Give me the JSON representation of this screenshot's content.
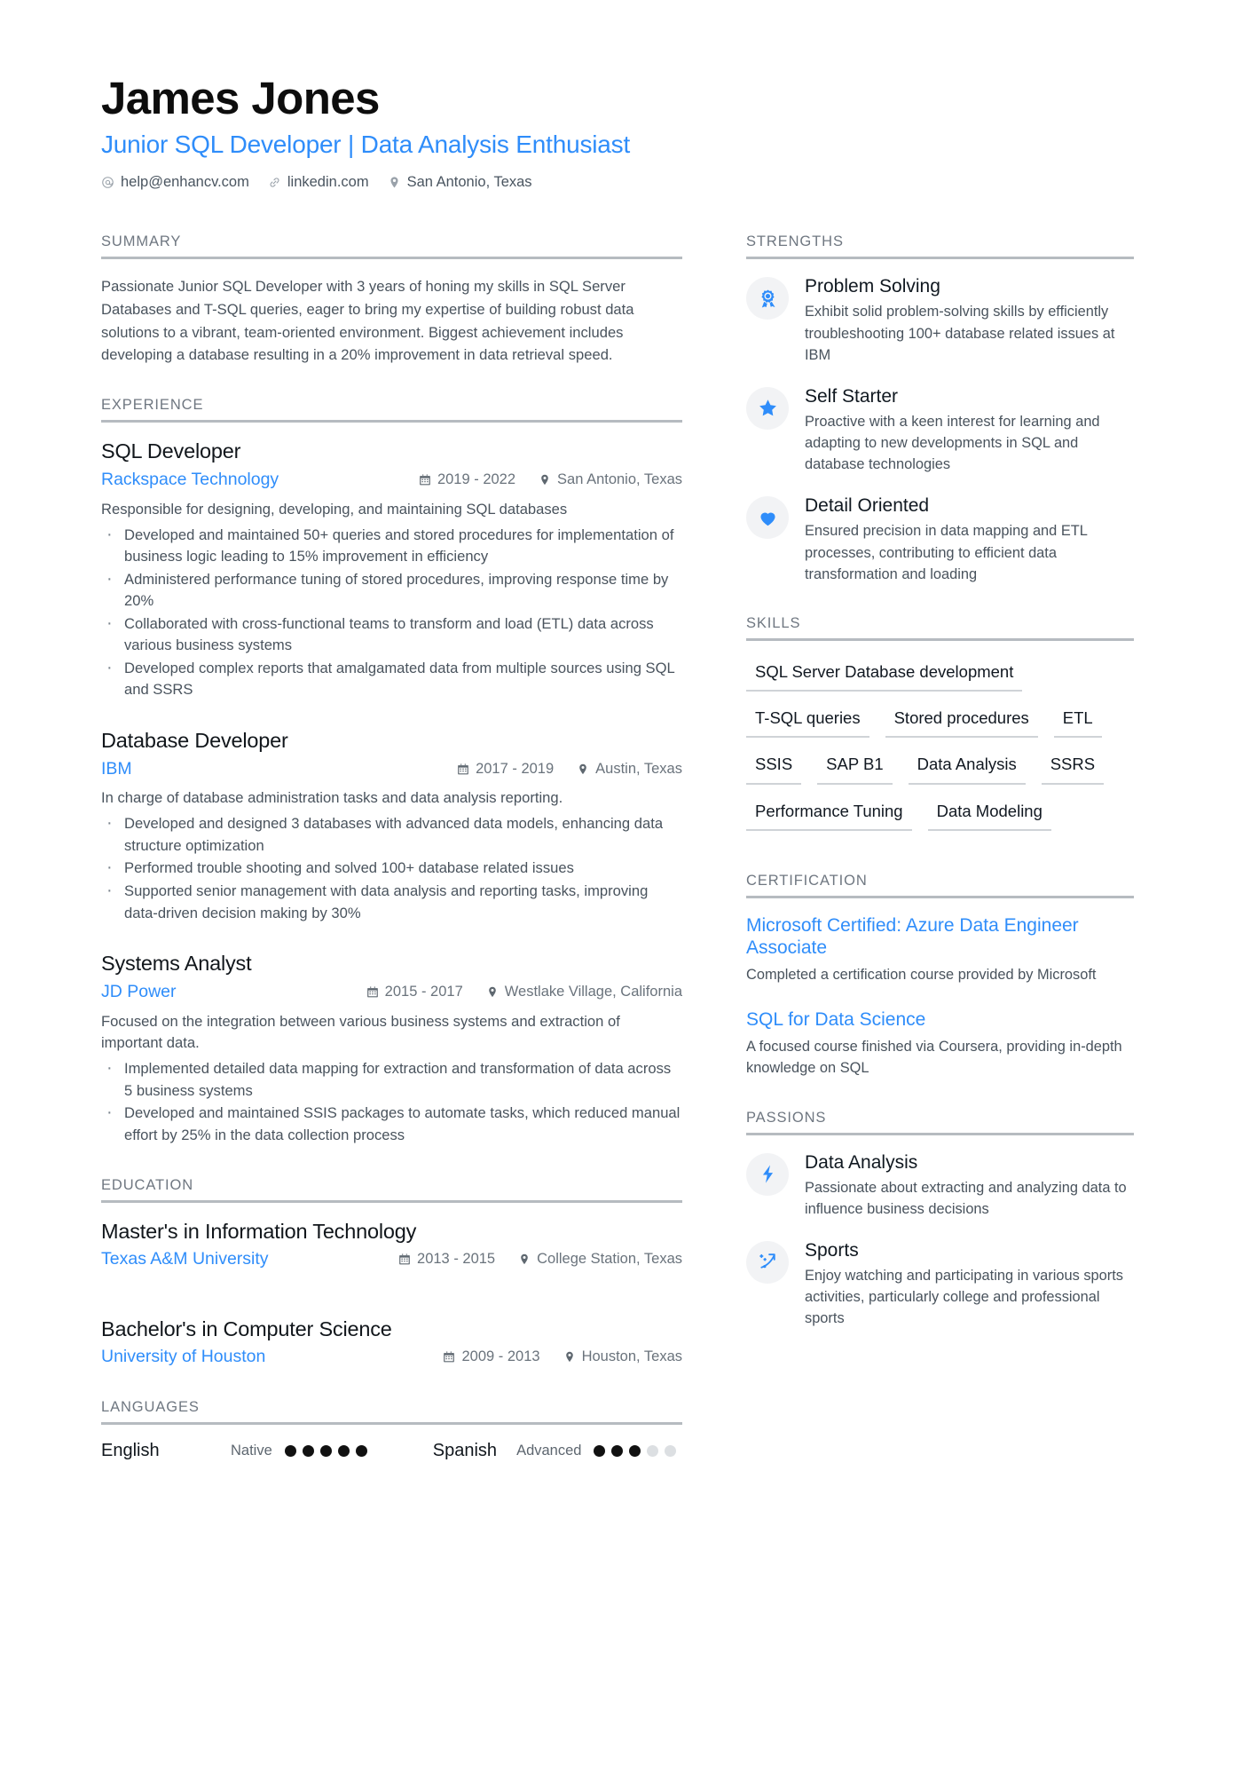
{
  "header": {
    "name": "James Jones",
    "headline": "Junior SQL Developer | Data Analysis Enthusiast",
    "contacts": [
      {
        "icon": "email-icon",
        "text": "help@enhancv.com"
      },
      {
        "icon": "link-icon",
        "text": "linkedin.com"
      },
      {
        "icon": "location-pin-icon",
        "text": "San Antonio, Texas"
      }
    ]
  },
  "sections": {
    "summary_title": "SUMMARY",
    "experience_title": "EXPERIENCE",
    "education_title": "EDUCATION",
    "languages_title": "LANGUAGES",
    "strengths_title": "STRENGTHS",
    "skills_title": "SKILLS",
    "certification_title": "CERTIFICATION",
    "passions_title": "PASSIONS"
  },
  "summary": {
    "text": "Passionate Junior SQL Developer with 3 years of honing my skills in SQL Server Databases and T-SQL queries, eager to bring my expertise of building robust data solutions to a vibrant, team-oriented environment. Biggest achievement includes developing a database resulting in a 20% improvement in data retrieval speed."
  },
  "experience": [
    {
      "title": "SQL Developer",
      "org": "Rackspace Technology",
      "dates": "2019 - 2022",
      "location": "San Antonio, Texas",
      "desc": "Responsible for designing, developing, and maintaining SQL databases",
      "bullets": [
        "Developed and maintained 50+ queries and stored procedures for implementation of business logic leading to 15% improvement in efficiency",
        "Administered performance tuning of stored procedures, improving response time by 20%",
        "Collaborated with cross-functional teams to transform and load (ETL) data across various business systems",
        "Developed complex reports that amalgamated data from multiple sources using SQL and SSRS"
      ]
    },
    {
      "title": "Database Developer",
      "org": "IBM",
      "dates": "2017 - 2019",
      "location": "Austin, Texas",
      "desc": "In charge of database administration tasks and data analysis reporting.",
      "bullets": [
        "Developed and designed 3 databases with advanced data models, enhancing data structure optimization",
        "Performed trouble shooting and solved 100+ database related issues",
        "Supported senior management with data analysis and reporting tasks, improving data-driven decision making by 30%"
      ]
    },
    {
      "title": "Systems Analyst",
      "org": "JD Power",
      "dates": "2015 - 2017",
      "location": "Westlake Village, California",
      "desc": "Focused on the integration between various business systems and extraction of important data.",
      "bullets": [
        "Implemented detailed data mapping for extraction and transformation of data across 5 business systems",
        "Developed and maintained SSIS packages to automate tasks, which reduced manual effort by 25% in the data collection process"
      ]
    }
  ],
  "education": [
    {
      "title": "Master's in Information Technology",
      "org": "Texas A&M University",
      "dates": "2013 - 2015",
      "location": "College Station, Texas"
    },
    {
      "title": "Bachelor's in Computer Science",
      "org": "University of Houston",
      "dates": "2009 - 2013",
      "location": "Houston, Texas"
    }
  ],
  "languages": [
    {
      "name": "English",
      "level": "Native",
      "filled": 5,
      "total": 5
    },
    {
      "name": "Spanish",
      "level": "Advanced",
      "filled": 3,
      "total": 5
    }
  ],
  "strengths": [
    {
      "icon": "award-ribbon-icon",
      "title": "Problem Solving",
      "desc": "Exhibit solid problem-solving skills by efficiently troubleshooting 100+ database related issues at IBM"
    },
    {
      "icon": "star-icon",
      "title": "Self Starter",
      "desc": "Proactive with a keen interest for learning and adapting to new developments in SQL and database technologies"
    },
    {
      "icon": "heart-icon",
      "title": "Detail Oriented",
      "desc": "Ensured precision in data mapping and ETL processes, contributing to efficient data transformation and loading"
    }
  ],
  "skills": [
    "SQL Server Database development",
    "T-SQL queries",
    "Stored procedures",
    "ETL",
    "SSIS",
    "SAP B1",
    "Data Analysis",
    "SSRS",
    "Performance Tuning",
    "Data Modeling"
  ],
  "certifications": [
    {
      "title": "Microsoft Certified: Azure Data Engineer Associate",
      "desc": "Completed a certification course provided by Microsoft"
    },
    {
      "title": "SQL for Data Science",
      "desc": "A focused course finished via Coursera, providing in-depth knowledge on SQL"
    }
  ],
  "passions": [
    {
      "icon": "lightning-bolt-icon",
      "title": "Data Analysis",
      "desc": "Passionate about extracting and analyzing data to influence business decisions"
    },
    {
      "icon": "sports-icon",
      "title": "Sports",
      "desc": "Enjoy watching and participating in various sports activities, particularly college and professional sports"
    }
  ],
  "colors": {
    "accent": "#2f8dfa",
    "heading": "#11161b",
    "body": "#49535d",
    "rule": "#b6bbc0",
    "icon_bg": "#f2f3f5"
  }
}
